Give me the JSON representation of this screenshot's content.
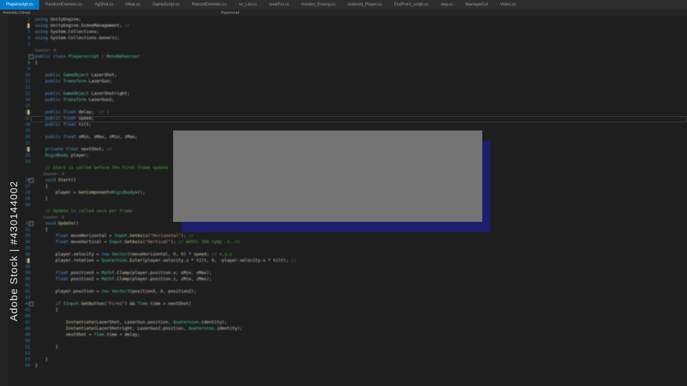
{
  "tabs": [
    {
      "label": "Playerscript.cs",
      "active": true
    },
    {
      "label": "RandomEnemies.cs",
      "active": false
    },
    {
      "label": "AgShot.cs",
      "active": false
    },
    {
      "label": "Meat.cs",
      "active": false
    },
    {
      "label": "GameScript.cs",
      "active": false
    },
    {
      "label": "RebootEnemies.cs",
      "active": false
    },
    {
      "label": "ss_List.cs",
      "active": false
    },
    {
      "label": "levelFol.cs",
      "active": false
    },
    {
      "label": "mission_Enemy.cs",
      "active": false
    },
    {
      "label": "Asteroid_Player.cs",
      "active": false
    },
    {
      "label": "EndPoint_script.cs",
      "active": false
    },
    {
      "label": "way.cs",
      "active": false
    },
    {
      "label": "ManagerCol",
      "active": false
    },
    {
      "label": "Video.cs",
      "active": false
    }
  ],
  "navbar": {
    "left": "Assembly-CSharp",
    "middle": "Playerscript"
  },
  "watermark": {
    "side_text": "Adobe Stock | #430144002"
  },
  "code_lines": [
    {
      "n": "1",
      "marker": false,
      "fold": "",
      "spans": [
        [
          "kw",
          "using "
        ],
        [
          "pl",
          "UnityEngine;"
        ]
      ]
    },
    {
      "n": "2",
      "marker": true,
      "fold": "",
      "spans": [
        [
          "kw",
          "using "
        ],
        [
          "pl",
          "UnityEngine.SceneManagement; "
        ],
        [
          "cm",
          "//"
        ]
      ]
    },
    {
      "n": "3",
      "marker": false,
      "fold": "",
      "spans": [
        [
          "kw",
          "using "
        ],
        [
          "pl",
          "System.Collections;"
        ]
      ]
    },
    {
      "n": "4",
      "marker": false,
      "fold": "",
      "spans": [
        [
          "kw",
          "using "
        ],
        [
          "pl",
          "System.Collections.Generic;"
        ]
      ]
    },
    {
      "n": "5",
      "marker": false,
      "fold": "",
      "spans": []
    },
    {
      "n": "",
      "marker": false,
      "fold": "",
      "spans": [
        [
          "lens",
          "Counter: 0"
        ]
      ]
    },
    {
      "n": "7",
      "marker": false,
      "fold": "−",
      "spans": [
        [
          "kw",
          "public class "
        ],
        [
          "ty",
          "Playerscript"
        ],
        [
          "pl",
          " : "
        ],
        [
          "ty",
          "MonoBehaviour"
        ]
      ]
    },
    {
      "n": "8",
      "marker": false,
      "fold": "",
      "spans": [
        [
          "pl",
          "{"
        ]
      ]
    },
    {
      "n": "9",
      "marker": false,
      "fold": "",
      "spans": []
    },
    {
      "n": "10",
      "marker": false,
      "fold": "",
      "spans": [
        [
          "kw",
          "    public "
        ],
        [
          "ty",
          "GameObject "
        ],
        [
          "pl",
          "LazerShot;"
        ]
      ]
    },
    {
      "n": "11",
      "marker": false,
      "fold": "",
      "spans": [
        [
          "kw",
          "    public "
        ],
        [
          "ty",
          "Transform "
        ],
        [
          "pl",
          "LazerGun;"
        ]
      ]
    },
    {
      "n": "12",
      "marker": false,
      "fold": "",
      "spans": []
    },
    {
      "n": "13",
      "marker": false,
      "fold": "",
      "spans": [
        [
          "kw",
          "    public "
        ],
        [
          "ty",
          "GameObject "
        ],
        [
          "pl",
          "LazerShotright;"
        ]
      ]
    },
    {
      "n": "14",
      "marker": false,
      "fold": "",
      "spans": [
        [
          "kw",
          "    public "
        ],
        [
          "ty",
          "Transform "
        ],
        [
          "pl",
          "LazerGun2;"
        ]
      ]
    },
    {
      "n": "15",
      "marker": false,
      "fold": "",
      "spans": []
    },
    {
      "n": "16",
      "marker": true,
      "fold": "",
      "spans": [
        [
          "kw",
          "    public float "
        ],
        [
          "pl",
          "delay;  "
        ],
        [
          "cm",
          "// |"
        ]
      ]
    },
    {
      "n": "17",
      "marker": false,
      "fold": "",
      "spans": [
        [
          "kw",
          "    public float "
        ],
        [
          "pl",
          "speed;"
        ]
      ]
    },
    {
      "n": "18",
      "marker": false,
      "fold": "",
      "spans": [
        [
          "kw",
          "    public float "
        ],
        [
          "pl",
          "tilt;"
        ]
      ]
    },
    {
      "n": "19",
      "marker": false,
      "fold": "",
      "spans": []
    },
    {
      "n": "20",
      "marker": false,
      "fold": "",
      "spans": [
        [
          "kw",
          "    public float "
        ],
        [
          "pl",
          "xMin, xMax, zMin, zMax;"
        ]
      ]
    },
    {
      "n": "21",
      "marker": false,
      "fold": "",
      "spans": []
    },
    {
      "n": "22",
      "marker": true,
      "fold": "",
      "spans": [
        [
          "kw",
          "    private float "
        ],
        [
          "pl",
          "nextShot; "
        ],
        [
          "cm",
          "//"
        ]
      ]
    },
    {
      "n": "23",
      "marker": false,
      "fold": "",
      "spans": [
        [
          "ty",
          "    Rigidbody "
        ],
        [
          "pl",
          "player;"
        ]
      ]
    },
    {
      "n": "24",
      "marker": false,
      "fold": "",
      "spans": []
    },
    {
      "n": "",
      "marker": false,
      "fold": "",
      "spans": [
        [
          "cm",
          "    // Start is called before the first frame update"
        ]
      ]
    },
    {
      "n": "",
      "marker": false,
      "fold": "",
      "spans": [
        [
          "lens",
          "    Counter: 0"
        ]
      ]
    },
    {
      "n": "26",
      "marker": false,
      "fold": "−",
      "spans": [
        [
          "kw",
          "    void "
        ],
        [
          "fn",
          "Start"
        ],
        [
          "pl",
          "()"
        ]
      ]
    },
    {
      "n": "27",
      "marker": false,
      "fold": "",
      "spans": [
        [
          "pl",
          "    {"
        ]
      ]
    },
    {
      "n": "28",
      "marker": false,
      "fold": "",
      "spans": [
        [
          "pl",
          "        player = "
        ],
        [
          "fn",
          "GetComponent"
        ],
        [
          "pl",
          "<"
        ],
        [
          "ty",
          "Rigidbody"
        ],
        [
          "pl",
          ">();"
        ]
      ]
    },
    {
      "n": "29",
      "marker": false,
      "fold": "",
      "spans": [
        [
          "pl",
          "    }"
        ]
      ]
    },
    {
      "n": "30",
      "marker": false,
      "fold": "",
      "spans": []
    },
    {
      "n": "",
      "marker": false,
      "fold": "",
      "spans": [
        [
          "cm",
          "    // Update is called once per frame"
        ]
      ]
    },
    {
      "n": "",
      "marker": false,
      "fold": "",
      "spans": [
        [
          "lens",
          "    Counter: 0"
        ]
      ]
    },
    {
      "n": "31",
      "marker": false,
      "fold": "−",
      "spans": [
        [
          "kw",
          "    void "
        ],
        [
          "fn",
          "Update"
        ],
        [
          "pl",
          "()"
        ]
      ]
    },
    {
      "n": "32",
      "marker": false,
      "fold": "",
      "spans": [
        [
          "pl",
          "    {"
        ]
      ]
    },
    {
      "n": "33",
      "marker": false,
      "fold": "",
      "spans": [
        [
          "kw",
          "        float "
        ],
        [
          "pl",
          "moveHorizontal = "
        ],
        [
          "ty",
          "Input"
        ],
        [
          "pl",
          "."
        ],
        [
          "fn",
          "GetAxis"
        ],
        [
          "pl",
          "("
        ],
        [
          "str",
          "\"Horizontal\""
        ],
        [
          "pl",
          "); "
        ],
        [
          "cm",
          "//"
        ]
      ]
    },
    {
      "n": "34",
      "marker": false,
      "fold": "",
      "spans": [
        [
          "kw",
          "        float "
        ],
        [
          "pl",
          "moveVertical = "
        ],
        [
          "ty",
          "Input"
        ],
        [
          "pl",
          "."
        ],
        [
          "fn",
          "GetAxis"
        ],
        [
          "pl",
          "("
        ],
        [
          "str",
          "\"Vertical\""
        ],
        [
          "pl",
          "); "
        ],
        [
          "cm",
          "// A0th( 3A6 dyBp -1..+1"
        ]
      ]
    },
    {
      "n": "35",
      "marker": false,
      "fold": "",
      "spans": []
    },
    {
      "n": "36",
      "marker": false,
      "fold": "",
      "spans": [
        [
          "pl",
          "        player.velocity = "
        ],
        [
          "kw",
          "new "
        ],
        [
          "ty",
          "Vector3"
        ],
        [
          "pl",
          "(moveHorizontal, "
        ],
        [
          "num",
          "0"
        ],
        [
          "pl",
          ", "
        ],
        [
          "num",
          "0"
        ],
        [
          "pl",
          ") * speed; "
        ],
        [
          "cm",
          "// x,y,z"
        ]
      ]
    },
    {
      "n": "37",
      "marker": true,
      "fold": "",
      "spans": [
        [
          "pl",
          "        player.rotation = "
        ],
        [
          "ty",
          "Quaternion"
        ],
        [
          "pl",
          "."
        ],
        [
          "fn",
          "Euler"
        ],
        [
          "pl",
          "(player.velocity.z * tilt, "
        ],
        [
          "num",
          "0"
        ],
        [
          "pl",
          ", -player.velocity.x * tilt); "
        ],
        [
          "cm",
          "//"
        ]
      ]
    },
    {
      "n": "38",
      "marker": false,
      "fold": "",
      "spans": []
    },
    {
      "n": "39",
      "marker": false,
      "fold": "",
      "spans": [
        [
          "kw",
          "        float "
        ],
        [
          "pl",
          "positionX = "
        ],
        [
          "ty",
          "Mathf"
        ],
        [
          "pl",
          "."
        ],
        [
          "fn",
          "Clamp"
        ],
        [
          "pl",
          "(player.position.x, xMin, xMax);"
        ]
      ]
    },
    {
      "n": "40",
      "marker": false,
      "fold": "",
      "spans": [
        [
          "kw",
          "        float "
        ],
        [
          "pl",
          "positionZ = "
        ],
        [
          "ty",
          "Mathf"
        ],
        [
          "pl",
          "."
        ],
        [
          "fn",
          "Clamp"
        ],
        [
          "pl",
          "(player.position.z, zMin, zMax);"
        ]
      ]
    },
    {
      "n": "41",
      "marker": false,
      "fold": "",
      "spans": []
    },
    {
      "n": "42",
      "marker": false,
      "fold": "",
      "spans": [
        [
          "pl",
          "        player.position = "
        ],
        [
          "kw",
          "new "
        ],
        [
          "ty",
          "Vector3"
        ],
        [
          "pl",
          "(positionX, "
        ],
        [
          "num",
          "0"
        ],
        [
          "pl",
          ", positionZ);"
        ]
      ]
    },
    {
      "n": "43",
      "marker": false,
      "fold": "",
      "spans": []
    },
    {
      "n": "44",
      "marker": false,
      "fold": "−",
      "spans": [
        [
          "kw",
          "        if "
        ],
        [
          "pl",
          "("
        ],
        [
          "ty",
          "Input"
        ],
        [
          "pl",
          "."
        ],
        [
          "fn",
          "GetButton"
        ],
        [
          "pl",
          "("
        ],
        [
          "str",
          "\"Fire1\""
        ],
        [
          "pl",
          ") && "
        ],
        [
          "ty",
          "Time"
        ],
        [
          "pl",
          ".time > nextShot)"
        ]
      ]
    },
    {
      "n": "45",
      "marker": false,
      "fold": "",
      "spans": [
        [
          "pl",
          "        {"
        ]
      ]
    },
    {
      "n": "46",
      "marker": false,
      "fold": "",
      "spans": []
    },
    {
      "n": "47",
      "marker": false,
      "fold": "",
      "spans": [
        [
          "fn",
          "            Instantiate"
        ],
        [
          "pl",
          "(LazerShot, LazerGun.position, "
        ],
        [
          "ty",
          "Quaternion"
        ],
        [
          "pl",
          ".identity);"
        ]
      ]
    },
    {
      "n": "48",
      "marker": false,
      "fold": "",
      "spans": [
        [
          "fn",
          "            Instantiate"
        ],
        [
          "pl",
          "(LazerShotright, LazerGun2.position, "
        ],
        [
          "ty",
          "Quaternion"
        ],
        [
          "pl",
          ".identity);"
        ]
      ]
    },
    {
      "n": "49",
      "marker": false,
      "fold": "",
      "spans": [
        [
          "pl",
          "            nextShot = "
        ],
        [
          "ty",
          "Time"
        ],
        [
          "pl",
          ".time + delay;"
        ]
      ]
    },
    {
      "n": "50",
      "marker": false,
      "fold": "",
      "spans": []
    },
    {
      "n": "51",
      "marker": false,
      "fold": "",
      "spans": [
        [
          "pl",
          "        }"
        ]
      ]
    },
    {
      "n": "52",
      "marker": false,
      "fold": "",
      "spans": []
    },
    {
      "n": "53",
      "marker": false,
      "fold": "",
      "spans": [
        [
          "pl",
          "    }"
        ]
      ]
    },
    {
      "n": "54",
      "marker": false,
      "fold": "",
      "spans": [
        [
          "pl",
          "}"
        ]
      ]
    }
  ],
  "colors": {
    "accent_tab": "#007acc",
    "overlay_front": "#737373",
    "overlay_back": "#1c1f6b"
  }
}
